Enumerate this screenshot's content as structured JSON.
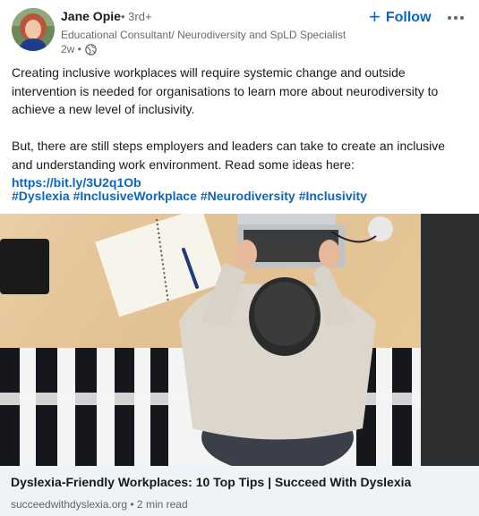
{
  "author": {
    "name": "Jane Opie",
    "degree": "• 3rd+",
    "headline": "Educational Consultant/ Neurodiversity and SpLD Specialist",
    "time": "2w •",
    "visibility_icon": "globe-icon"
  },
  "actions": {
    "follow_label": "Follow",
    "follow_icon": "plus-icon",
    "more_icon": "ellipsis-icon"
  },
  "post": {
    "paragraph1": "Creating inclusive workplaces will require systemic change and outside intervention is needed for organisations to learn more about neurodiversity to achieve a new level of inclusivity.",
    "paragraph2": "But, there are still steps employers and leaders can take to create an inclusive and understanding work environment. Read some ideas here:",
    "link": "https://bit.ly/3U2q1Ob",
    "hashtags": [
      "#Dyslexia",
      "#InclusiveWorkplace",
      "#Neurodiversity",
      "#Inclusivity"
    ]
  },
  "article": {
    "title": "Dyslexia-Friendly Workplaces: 10 Top Tips | Succeed With Dyslexia",
    "source": "succeedwithdyslexia.org • 2 min read"
  },
  "colors": {
    "link": "#0a66c2",
    "footer_bg": "#eef3f8",
    "desk": "#e6c79c"
  }
}
